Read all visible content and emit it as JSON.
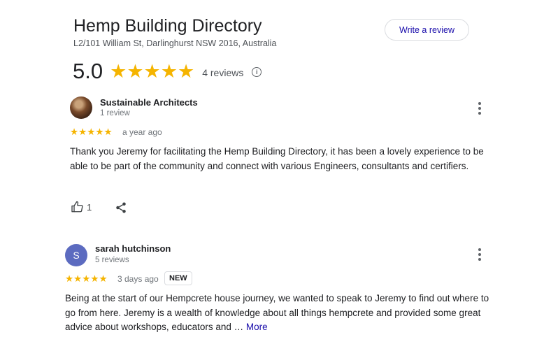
{
  "business": {
    "name": "Hemp Building Directory",
    "address": "L2/101 William St, Darlinghurst NSW 2016, Australia",
    "rating": "5.0",
    "rating_stars": 5,
    "review_count": "4 reviews",
    "write_review_label": "Write a review",
    "info_icon": "info-icon"
  },
  "reviews": [
    {
      "author": "Sustainable Architects",
      "author_meta": "1 review",
      "avatar": "photo",
      "stars": 5,
      "time": "a year ago",
      "text": "Thank you Jeremy for facilitating the Hemp Building Directory, it has been a lovely experience to be able to be part of the community and connect with various Engineers, consultants and certifiers.",
      "like_count": "1"
    },
    {
      "author": "sarah hutchinson",
      "author_meta": "5 reviews",
      "avatar_letter": "S",
      "avatar_color": "#5c6bc0",
      "stars": 5,
      "time": "3 days ago",
      "badge": "NEW",
      "text": "Being at the start of our Hempcrete house journey, we wanted to speak to Jeremy to find out where to go from here. Jeremy is a wealth of knowledge about all things hempcrete and provided some great advice about workshops, educators and …",
      "more_label": "More"
    }
  ],
  "colors": {
    "star": "#f5b400",
    "link": "#1a0dab",
    "avatar": "#5c6bc0"
  }
}
